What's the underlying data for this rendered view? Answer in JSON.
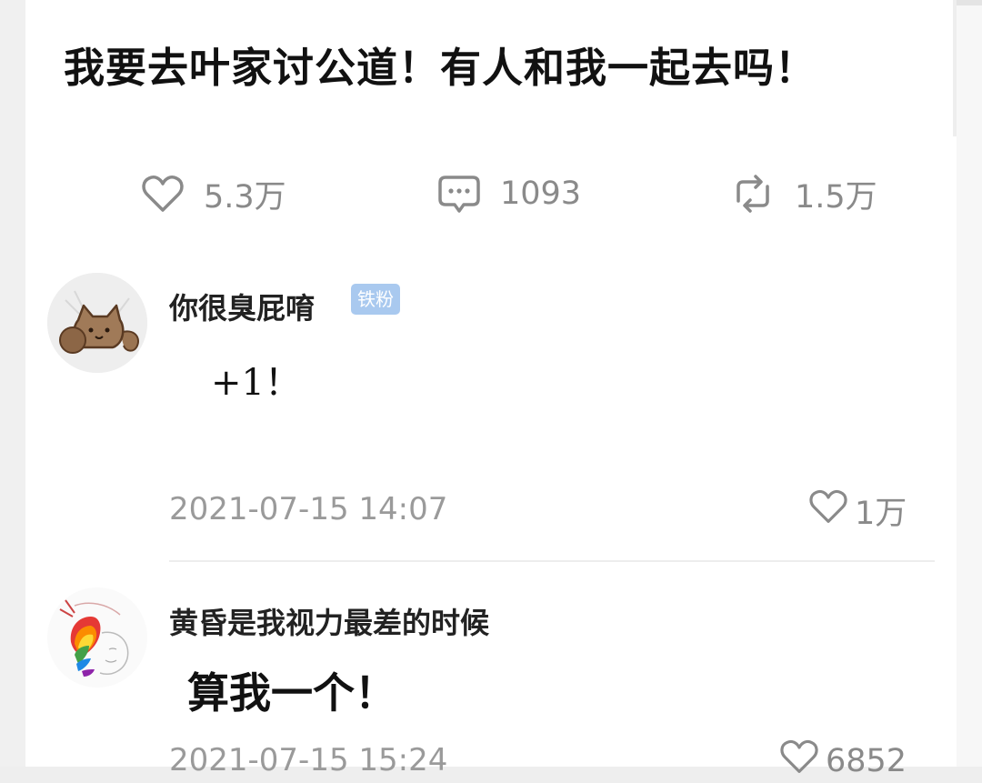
{
  "post": {
    "title": "我要去叶家讨公道！有人和我一起去吗！"
  },
  "stats": {
    "likes": "5.3万",
    "comments": "1093",
    "reposts": "1.5万"
  },
  "comments": [
    {
      "username": "你很臭屁唷",
      "badge": "铁粉",
      "text": "+1！",
      "date": "2021-07-15 14:07",
      "likes": "1万",
      "avatar": "cat-avatar"
    },
    {
      "username": "黄昏是我视力最差的时候",
      "text": "算我一个！",
      "date": "2021-07-15 15:24",
      "likes": "6852",
      "avatar": "rainbow-hair-avatar"
    }
  ],
  "icons": {
    "like": "heart-icon",
    "comment": "comment-bubble-icon",
    "repost": "repost-icon"
  },
  "colors": {
    "badge": "#a9c9ef",
    "muted": "#8a8a8a"
  }
}
